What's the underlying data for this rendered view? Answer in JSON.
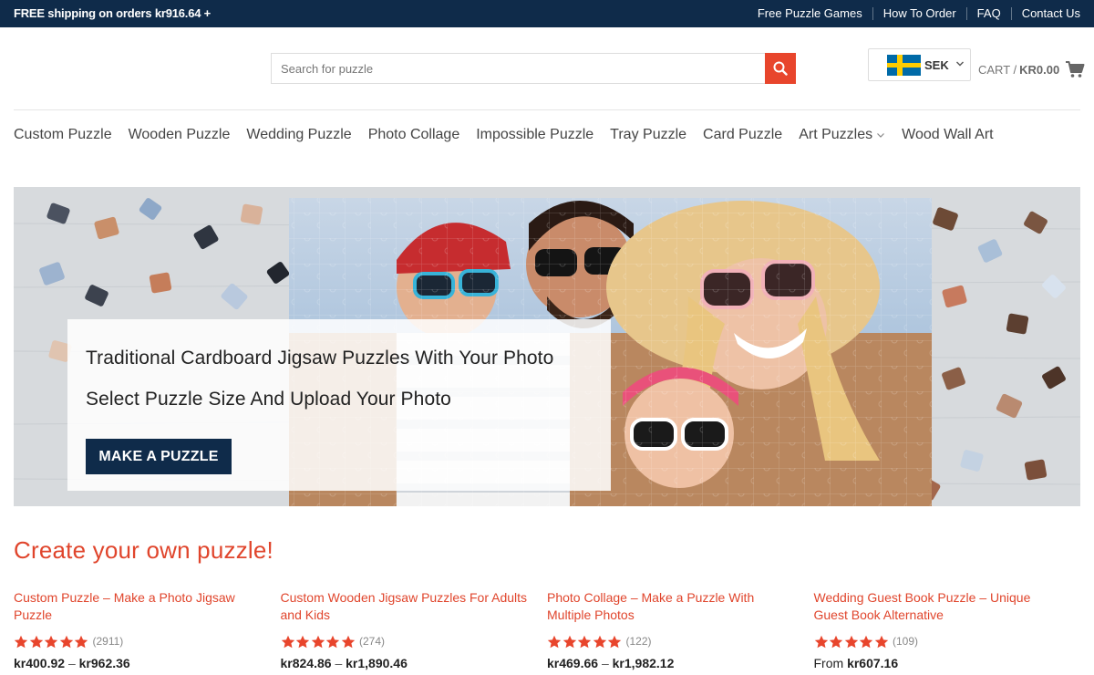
{
  "topbar": {
    "promo": "FREE shipping on orders kr916.64 +",
    "links": [
      "Free Puzzle Games",
      "How To Order",
      "FAQ",
      "Contact Us"
    ]
  },
  "header": {
    "search_placeholder": "Search for puzzle",
    "currency": "SEK",
    "cart_label": "CART /",
    "cart_amount": "KR0.00"
  },
  "nav": {
    "items": [
      "Custom Puzzle",
      "Wooden Puzzle",
      "Wedding Puzzle",
      "Photo Collage",
      "Impossible Puzzle",
      "Tray Puzzle",
      "Card Puzzle",
      "Art Puzzles",
      "Wood Wall Art"
    ]
  },
  "hero": {
    "line1": "Traditional Cardboard Jigsaw Puzzles With Your Photo",
    "line2": "Select Puzzle Size And Upload Your Photo",
    "cta": "MAKE A PUZZLE"
  },
  "section": {
    "title": "Create your own puzzle!"
  },
  "products": [
    {
      "title": "Custom Puzzle – Make a Photo Jigsaw Puzzle",
      "rating": 5,
      "count": "(2911)",
      "price_from": "",
      "price_low": "kr400.92",
      "price_sep": " – ",
      "price_high": "kr962.36"
    },
    {
      "title": "Custom Wooden Jigsaw Puzzles For Adults and Kids",
      "rating": 5,
      "count": "(274)",
      "price_from": "",
      "price_low": "kr824.86",
      "price_sep": " – ",
      "price_high": "kr1,890.46"
    },
    {
      "title": "Photo Collage – Make a Puzzle With Multiple Photos",
      "rating": 5,
      "count": "(122)",
      "price_from": "",
      "price_low": "kr469.66",
      "price_sep": " – ",
      "price_high": "kr1,982.12"
    },
    {
      "title": "Wedding Guest Book Puzzle – Unique Guest Book Alternative",
      "rating": 5,
      "count": "(109)",
      "price_from": "From ",
      "price_low": "kr607.16",
      "price_sep": "",
      "price_high": ""
    }
  ],
  "colors": {
    "navy": "#0f2b4a",
    "accent": "#e8452c",
    "star": "#e8452c"
  },
  "icons": {
    "search": "search-icon",
    "cart": "shopping-cart-icon",
    "flag": "sweden-flag-icon",
    "chevron": "chevron-down-icon",
    "star": "star-icon"
  }
}
